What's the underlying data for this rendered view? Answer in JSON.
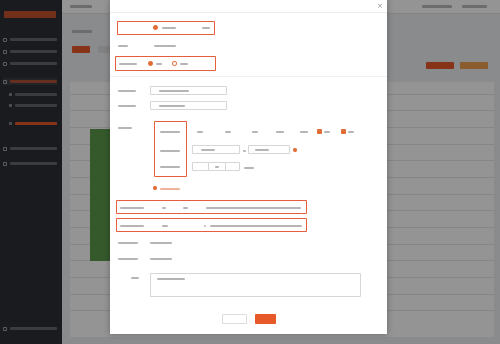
{
  "sidebar": {
    "brand": "",
    "items": [
      {
        "label": ""
      },
      {
        "label": ""
      },
      {
        "label": ""
      },
      {
        "label": ""
      },
      {
        "label": ""
      },
      {
        "label": ""
      },
      {
        "label": ""
      },
      {
        "label": ""
      },
      {
        "label": ""
      }
    ],
    "footer": ""
  },
  "modal": {
    "title": "",
    "fields": [
      {
        "label": "",
        "value": ""
      },
      {
        "label": "",
        "value": ""
      },
      {
        "label": "",
        "value": ""
      },
      {
        "label": "",
        "value": ""
      },
      {
        "label": "",
        "value": ""
      },
      {
        "label": "",
        "value": ""
      },
      {
        "label": "",
        "value": ""
      },
      {
        "label": "",
        "value": ""
      },
      {
        "label": "",
        "value": ""
      },
      {
        "label": "",
        "value": ""
      }
    ],
    "remark_label": "",
    "remark_counter": "",
    "cancel_label": "",
    "ok_label": ""
  },
  "colors": {
    "accent": "#e8592a",
    "sidebar": "#2b2f36",
    "highlight": "#e5603a",
    "chart_green": "#5c9a4a"
  }
}
